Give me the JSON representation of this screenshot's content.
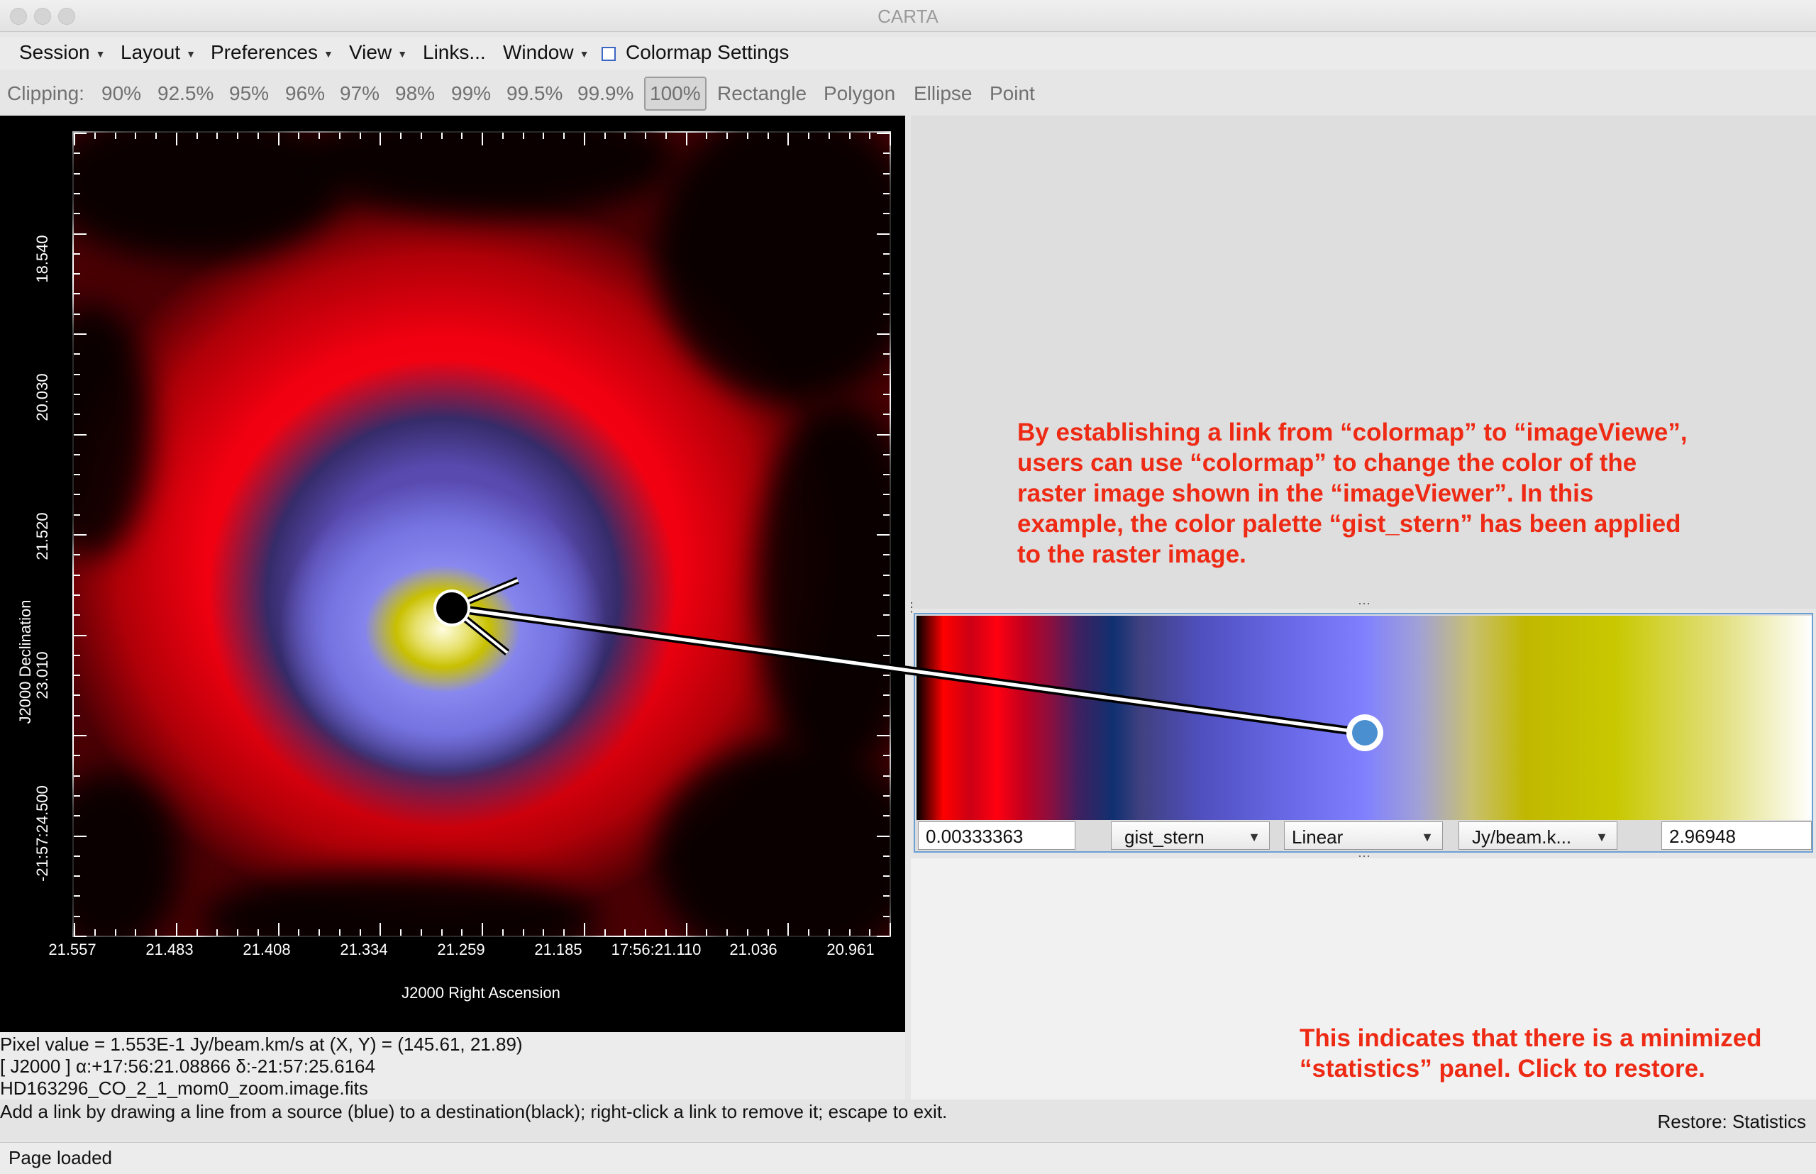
{
  "window": {
    "title": "CARTA"
  },
  "menu": {
    "items": [
      {
        "label": "Session",
        "has_caret": true
      },
      {
        "label": "Layout",
        "has_caret": true
      },
      {
        "label": "Preferences",
        "has_caret": true
      },
      {
        "label": "View",
        "has_caret": true
      },
      {
        "label": "Links...",
        "has_caret": false
      },
      {
        "label": "Window",
        "has_caret": true
      }
    ],
    "colormap_settings": "Colormap Settings"
  },
  "toolbar": {
    "clipping_label": "Clipping:",
    "clipping": [
      "90%",
      "92.5%",
      "95%",
      "96%",
      "97%",
      "98%",
      "99%",
      "99.5%",
      "99.9%",
      "100%"
    ],
    "clipping_selected": "100%",
    "regions": [
      "Rectangle",
      "Polygon",
      "Ellipse",
      "Point"
    ]
  },
  "image": {
    "y_ticks": [
      "18.540",
      "20.030",
      "21.520",
      "23.010",
      "-21:57:24.500"
    ],
    "x_ticks": [
      "21.557",
      "21.483",
      "21.408",
      "21.334",
      "21.259",
      "21.185",
      "17:56:21.110",
      "21.036",
      "20.961"
    ],
    "ylabel": "J2000 Declination",
    "xlabel": "J2000 Right Ascension"
  },
  "info": {
    "pixel_value": "Pixel value = 1.553E-1 Jy/beam.km/s at (X, Y) = (145.61, 21.89)",
    "coords": "[ J2000 ] α:+17:56:21.08866 δ:-21:57:25.6164",
    "filename": "HD163296_CO_2_1_mom0_zoom.image.fits"
  },
  "colormap": {
    "min": "0.00333363",
    "name": "gist_stern",
    "scale": "Linear",
    "unit": "Jy/beam.k...",
    "max": "2.96948"
  },
  "annotations": {
    "link_lines": [
      "By establishing a link from “colormap” to “imageViewe”,",
      "users can use “colormap” to change the color of the",
      "raster image shown in the “imageViewer”. In this",
      "example, the color palette “gist_stern” has been applied",
      "to the raster image."
    ],
    "minimized_lines": [
      "This indicates that there is a minimized",
      "“statistics” panel. Click to restore."
    ]
  },
  "hint": "Add a link by drawing a line from a source (blue) to a destination(black); right-click a link to remove it; escape to exit.",
  "restore_button": "Restore: Statistics",
  "status": "Page loaded",
  "colors": {
    "annotation": "#ee2a14",
    "link_source": "#4a90d0",
    "link_destination": "#000000"
  },
  "icons": [
    "window-close-light",
    "window-minimize-light",
    "window-zoom-light",
    "caret-down-icon",
    "checkbox-icon"
  ]
}
